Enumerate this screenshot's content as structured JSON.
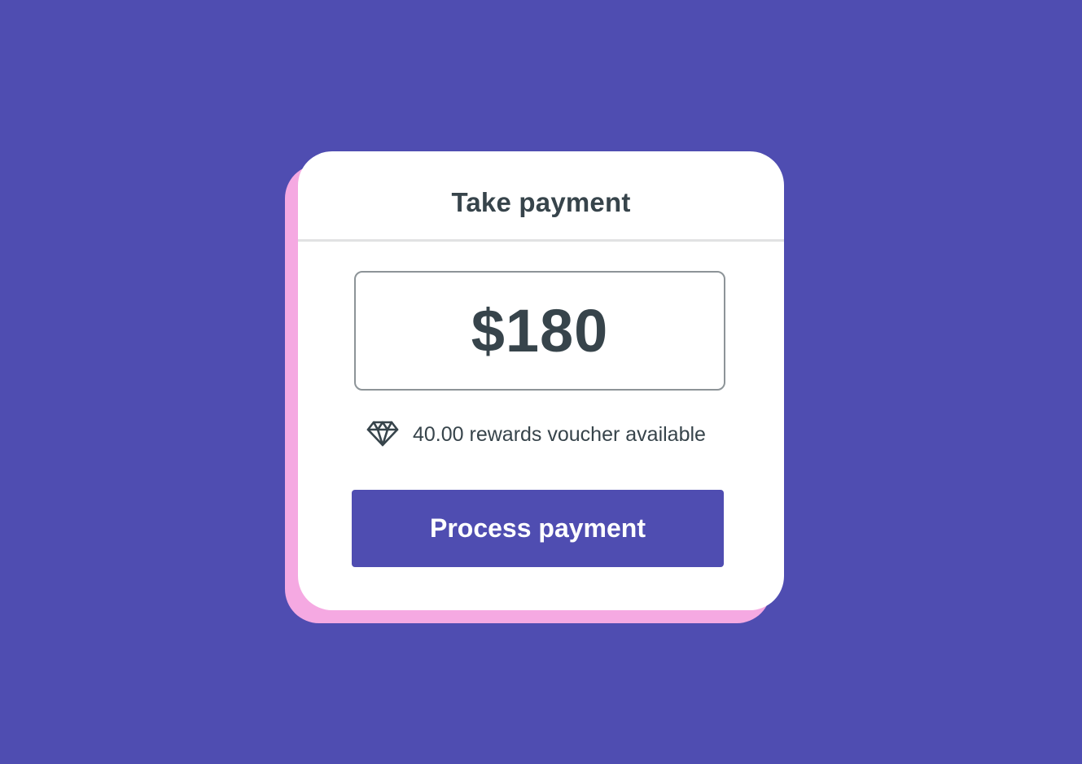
{
  "dialog": {
    "title": "Take payment",
    "amount": "$180",
    "rewards": {
      "icon": "diamond-icon",
      "text": "40.00 rewards voucher available"
    },
    "process_button_label": "Process payment"
  },
  "colors": {
    "background": "#4f4db1",
    "card_accent_shadow": "#f5a9e2",
    "card": "#ffffff",
    "text": "#37444b",
    "button": "#4f4db1",
    "button_text": "#ffffff"
  }
}
